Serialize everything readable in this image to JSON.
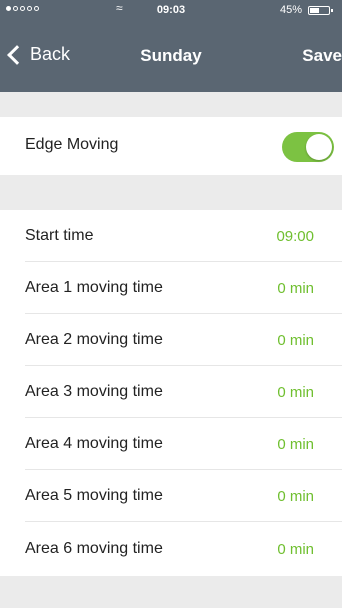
{
  "status_bar": {
    "time": "09:03",
    "battery_percent": "45%"
  },
  "nav": {
    "back_label": "Back",
    "title": "Sunday",
    "save_label": "Save"
  },
  "edge_moving": {
    "label": "Edge Moving",
    "enabled": true
  },
  "schedule": {
    "start_time": {
      "label": "Start time",
      "value": "09:00"
    },
    "areas": [
      {
        "label": "Area 1 moving time",
        "value": "0 min"
      },
      {
        "label": "Area 2 moving time",
        "value": "0 min"
      },
      {
        "label": "Area 3 moving time",
        "value": "0 min"
      },
      {
        "label": "Area 4 moving time",
        "value": "0 min"
      },
      {
        "label": "Area 5 moving time",
        "value": "0 min"
      },
      {
        "label": "Area 6 moving time",
        "value": "0 min"
      }
    ]
  },
  "colors": {
    "header": "#5a6672",
    "accent_green": "#6fbf2f",
    "toggle_green": "#7cc242",
    "background": "#ebebeb"
  }
}
